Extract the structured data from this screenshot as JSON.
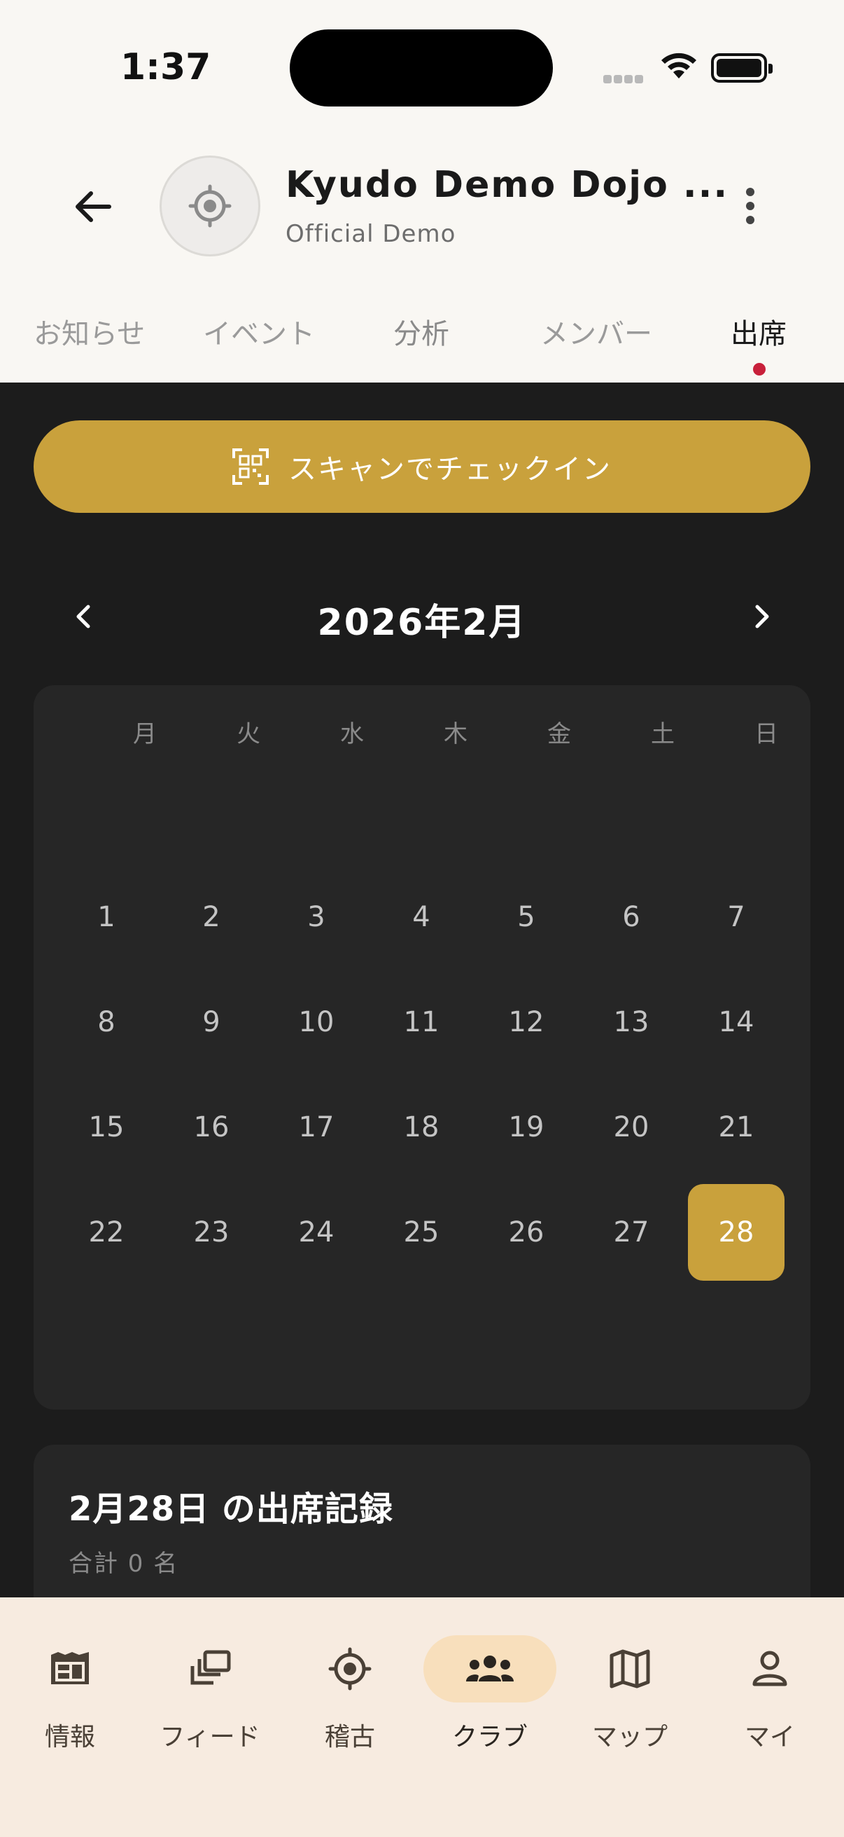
{
  "status_bar": {
    "time": "1:37"
  },
  "header": {
    "club_name": "Kyudo Demo Dojo ...",
    "club_subtitle": "Official Demo"
  },
  "tabs": [
    {
      "label": "お知らせ",
      "active": false
    },
    {
      "label": "イベント",
      "active": false
    },
    {
      "label": "分析",
      "active": false
    },
    {
      "label": "メンバー",
      "active": false
    },
    {
      "label": "出席",
      "active": true
    }
  ],
  "scan_button": {
    "label": "スキャンでチェックイン"
  },
  "calendar": {
    "month_title": "2026年2月",
    "weekdays": [
      "月",
      "火",
      "水",
      "木",
      "金",
      "土",
      "日"
    ],
    "weeks": [
      [
        "1",
        "2",
        "3",
        "4",
        "5",
        "6",
        "7"
      ],
      [
        "8",
        "9",
        "10",
        "11",
        "12",
        "13",
        "14"
      ],
      [
        "15",
        "16",
        "17",
        "18",
        "19",
        "20",
        "21"
      ],
      [
        "22",
        "23",
        "24",
        "25",
        "26",
        "27",
        "28"
      ]
    ],
    "selected_day": "28"
  },
  "attendance": {
    "title": "2月28日 の出席記録",
    "count": "合計 0 名"
  },
  "bottom_nav": [
    {
      "label": "情報",
      "icon": "newspaper-icon",
      "active": false
    },
    {
      "label": "フィード",
      "icon": "stack-icon",
      "active": false
    },
    {
      "label": "稽古",
      "icon": "target-icon",
      "active": false
    },
    {
      "label": "クラブ",
      "icon": "group-icon",
      "active": true
    },
    {
      "label": "マップ",
      "icon": "map-icon",
      "active": false
    },
    {
      "label": "マイ",
      "icon": "person-icon",
      "active": false
    }
  ],
  "colors": {
    "accent": "#c9a13c",
    "background": "#1c1c1c",
    "card": "#262626",
    "tab_indicator": "#c8203a",
    "nav_active": "#f8dfbc"
  }
}
